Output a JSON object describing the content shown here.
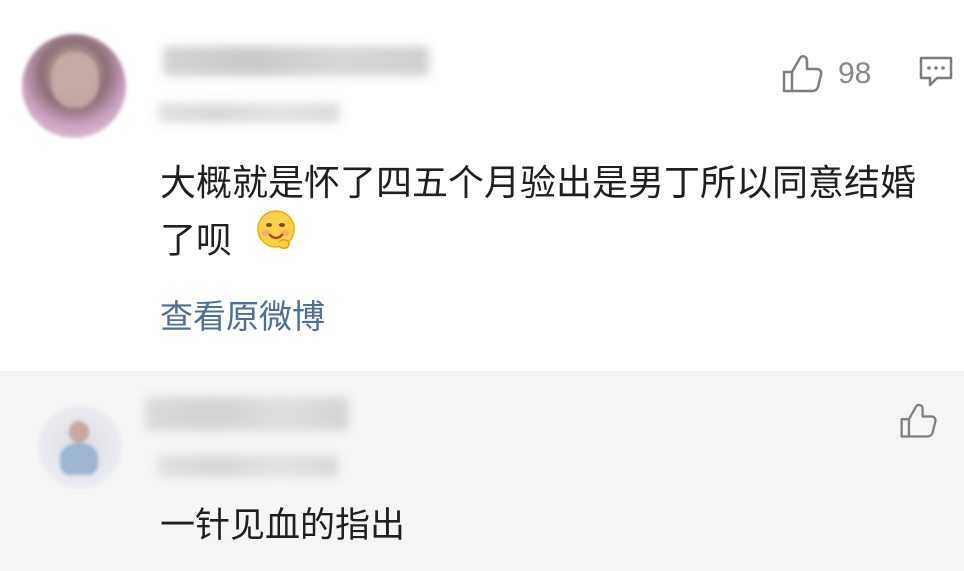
{
  "comment": {
    "likes": "98",
    "content": "大概就是怀了四五个月验出是男丁所以同意结婚了呗",
    "view_original": "查看原微博"
  },
  "reply": {
    "content": "一针见血的指出"
  },
  "icons": {
    "like": "thumbs-up-icon",
    "comment": "comment-icon",
    "emoji": "smiling-face-emoji"
  },
  "colors": {
    "link": "#4c6f99",
    "muted": "#888888",
    "reply_bg": "#f5f5f5"
  }
}
